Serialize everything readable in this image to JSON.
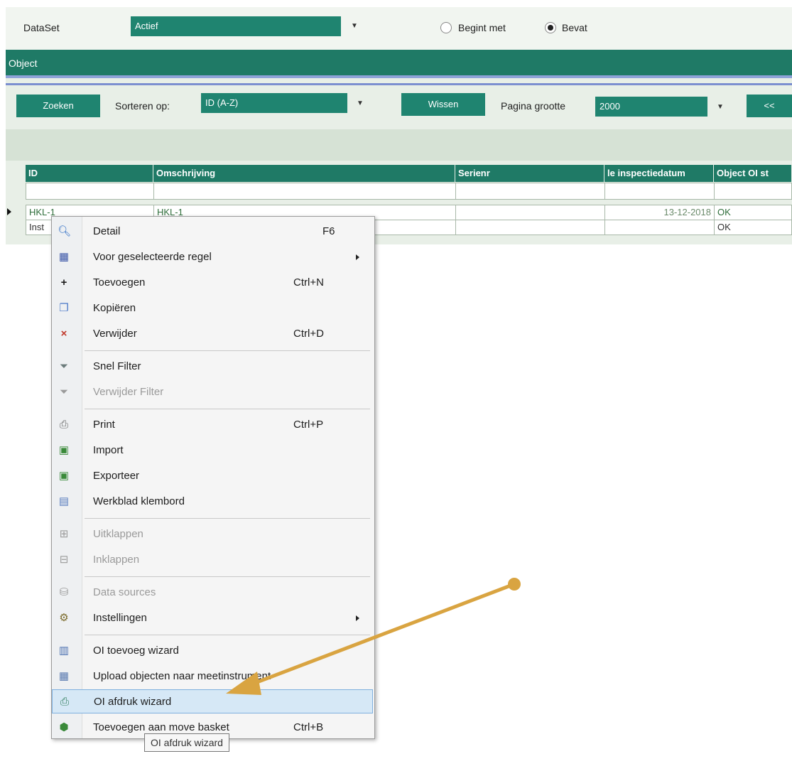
{
  "toolbar": {
    "dataset_label": "DataSet",
    "dataset_value": "Actief",
    "radio_begint": "Begint met",
    "radio_bevat": "Bevat",
    "radio_selected": "Bevat"
  },
  "section": {
    "title": "Object"
  },
  "search": {
    "zoeken": "Zoeken",
    "sorteren_label": "Sorteren op:",
    "sorteren_value": "ID (A-Z)",
    "wissen": "Wissen",
    "pagina_label": "Pagina grootte",
    "pagina_value": "2000",
    "prev": "<<"
  },
  "grid": {
    "columns": [
      "ID",
      "Omschrijving",
      "Serienr",
      "le inspectiedatum",
      "Object OI st"
    ],
    "rows": [
      {
        "id": "HKL-1",
        "omschrijving": "HKL-1",
        "serienr": "",
        "datum": "13-12-2018",
        "status": "OK"
      },
      {
        "id": "Inst",
        "omschrijving": "",
        "serienr": "",
        "datum": "",
        "status": "OK"
      }
    ]
  },
  "context_menu": {
    "items": [
      {
        "label": "Detail",
        "shortcut": "F6",
        "icon": "magnifier-icon"
      },
      {
        "label": "Voor geselecteerde regel",
        "shortcut": "",
        "icon": "row-select-icon",
        "submenu": true
      },
      {
        "label": "Toevoegen",
        "shortcut": "Ctrl+N",
        "icon": "plus-icon"
      },
      {
        "label": "Kopiëren",
        "shortcut": "",
        "icon": "copy-icon"
      },
      {
        "label": "Verwijder",
        "shortcut": "Ctrl+D",
        "icon": "delete-x-icon"
      },
      {
        "label": "Snel Filter",
        "shortcut": "",
        "icon": "filter-icon"
      },
      {
        "label": "Verwijder Filter",
        "shortcut": "",
        "icon": "remove-filter-icon",
        "disabled": true
      },
      {
        "label": "Print",
        "shortcut": "Ctrl+P",
        "icon": "printer-icon"
      },
      {
        "label": "Import",
        "shortcut": "",
        "icon": "import-icon"
      },
      {
        "label": "Exporteer",
        "shortcut": "",
        "icon": "export-icon"
      },
      {
        "label": "Werkblad klembord",
        "shortcut": "",
        "icon": "clipboard-icon"
      },
      {
        "label": "Uitklappen",
        "shortcut": "",
        "icon": "expand-icon",
        "disabled": true
      },
      {
        "label": "Inklappen",
        "shortcut": "",
        "icon": "collapse-icon",
        "disabled": true
      },
      {
        "label": "Data sources",
        "shortcut": "",
        "icon": "database-icon",
        "disabled": true
      },
      {
        "label": "Instellingen",
        "shortcut": "",
        "icon": "settings-icon",
        "submenu": true
      },
      {
        "label": "OI toevoeg wizard",
        "shortcut": "",
        "icon": "wizard-icon"
      },
      {
        "label": "Upload objecten naar meetinstrument",
        "shortcut": "",
        "icon": "upload-icon"
      },
      {
        "label": "OI afdruk wizard",
        "shortcut": "",
        "icon": "print-wizard-icon",
        "highlighted": true
      },
      {
        "label": "Toevoegen aan move basket",
        "shortcut": "Ctrl+B",
        "icon": "basket-icon"
      }
    ]
  },
  "tooltip": {
    "text": "OI afdruk wizard"
  },
  "annotation": {
    "arrow_color": "#d9a441"
  }
}
